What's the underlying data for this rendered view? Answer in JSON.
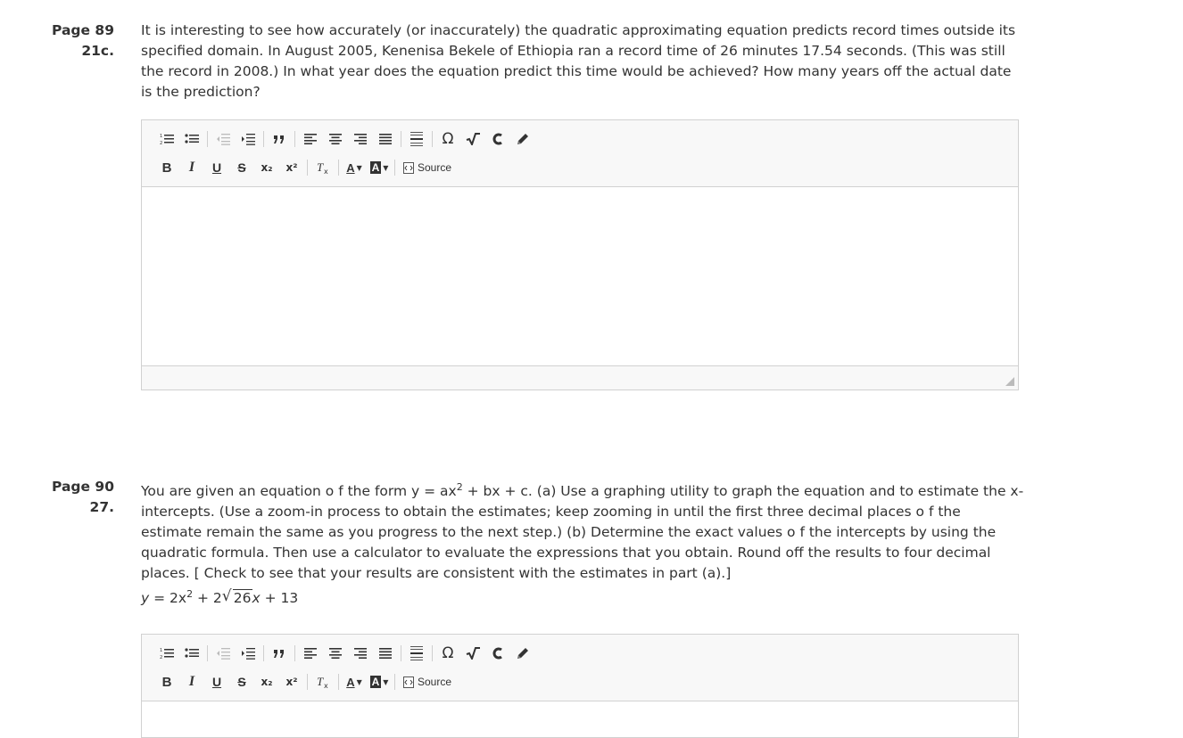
{
  "questions": [
    {
      "page": "Page 89",
      "number": "21c.",
      "text": "It is interesting to see how accurately (or inaccurately) the quadratic approximating equation predicts record times outside its specified domain. In August 2005, Kenenisa Bekele of Ethiopia ran a record time of 26 minutes 17.54 seconds. (This was still the record in 2008.) In what year does the equation predict this time would be achieved? How many years off the actual date is the prediction?"
    },
    {
      "page": "Page 90",
      "number": "27.",
      "text_before_sup": "You are given an equation o f the form y = ax",
      "text_sup": "2",
      "text_after_sup": " + bx + c. (a) Use a graphing utility to graph the equation and to estimate the x-intercepts. (Use a zoom-in process to obtain the estimates; keep zooming in until the first three decimal places o f the estimate remain the same as you progress to the next step.) (b) Determine the exact values o f the intercepts by using the quadratic formula. Then use a calculator to evaluate the expressions that you obtain. Round off the results to four decimal places. [ Check to see that your results are consistent with the estimates in part (a).]",
      "equation": {
        "lhs": "y",
        "mid1": " = 2x",
        "sup": "2",
        "mid2": " + 2",
        "radicand": "26",
        "tail_var": "x",
        "tail": " + 13"
      }
    }
  ],
  "toolbar": {
    "omega": "Ω",
    "bold": "B",
    "italic": "I",
    "underline": "U",
    "strike": "S",
    "subscript": "x₂",
    "superscript": "x²",
    "text_color": "A",
    "bg_color": "A",
    "source_label": "Source"
  },
  "colors": {
    "text": "#333333",
    "toolbar_bg": "#f8f8f8",
    "border": "#d1d1d1"
  }
}
